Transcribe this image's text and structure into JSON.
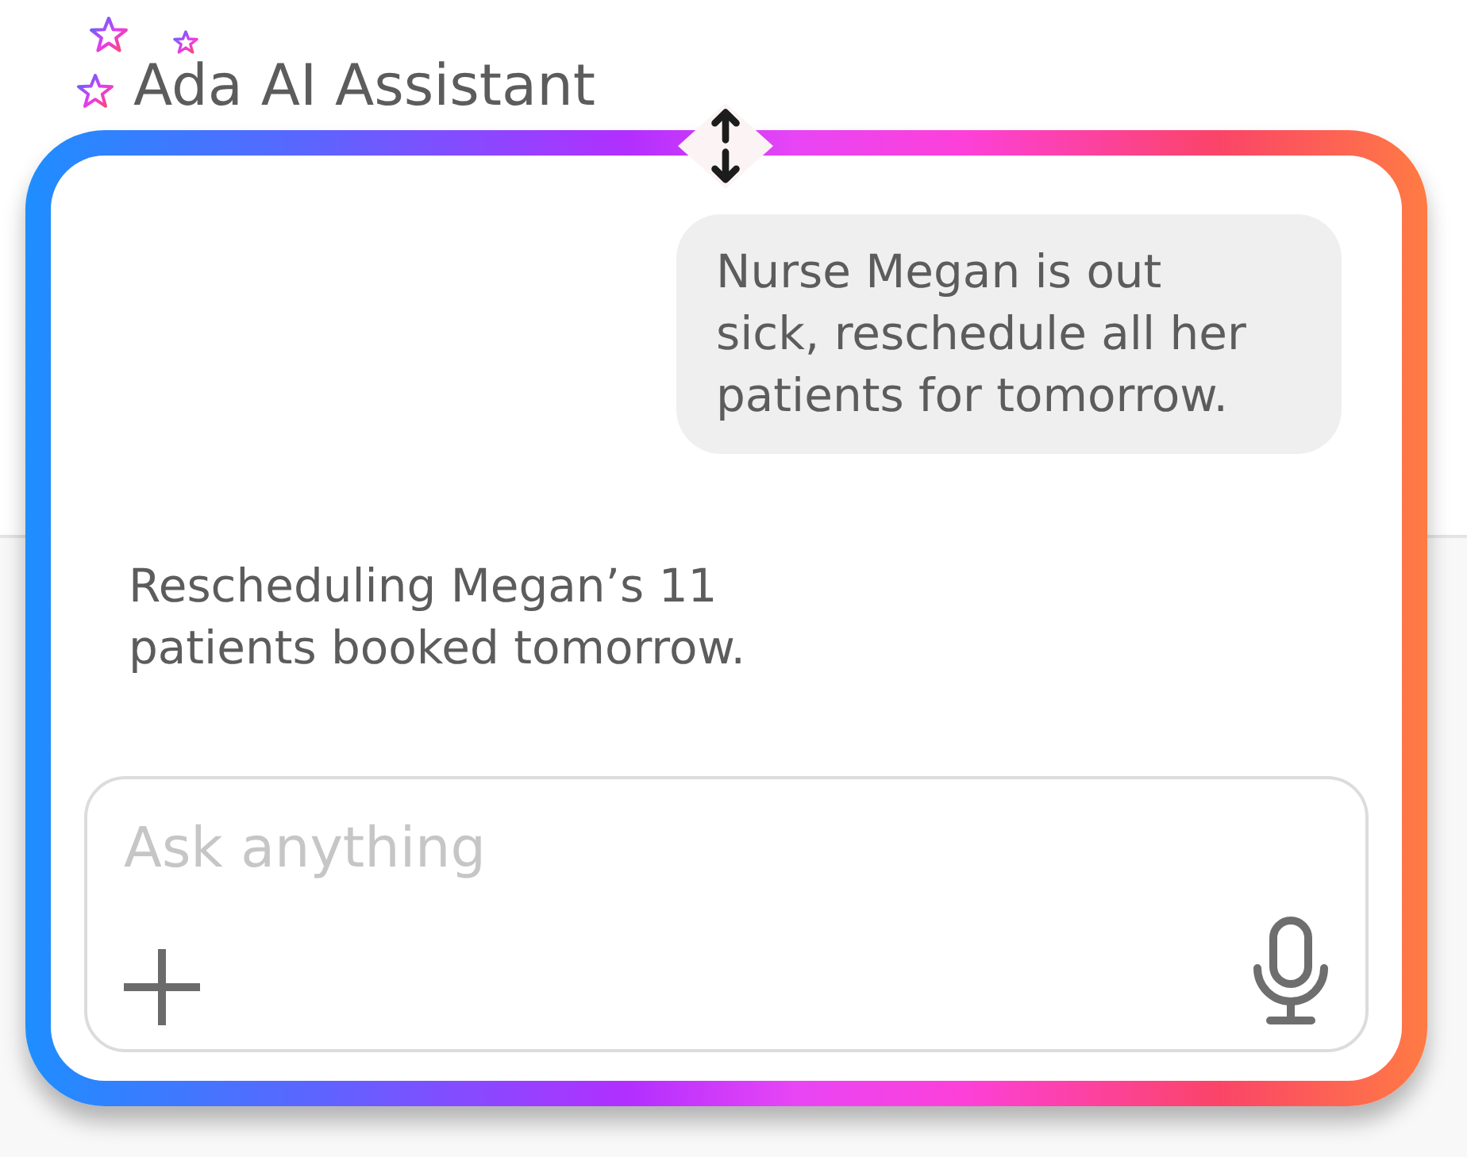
{
  "title": "Ada AI Assistant",
  "messages": [
    {
      "kind": "user",
      "text": "Nurse Megan is out sick, reschedule all her patients for tomorrow."
    },
    {
      "kind": "assistant",
      "text": "Rescheduling Megan’s 11 patients booked tomorrow."
    }
  ],
  "composer": {
    "placeholder": "Ask anything"
  }
}
